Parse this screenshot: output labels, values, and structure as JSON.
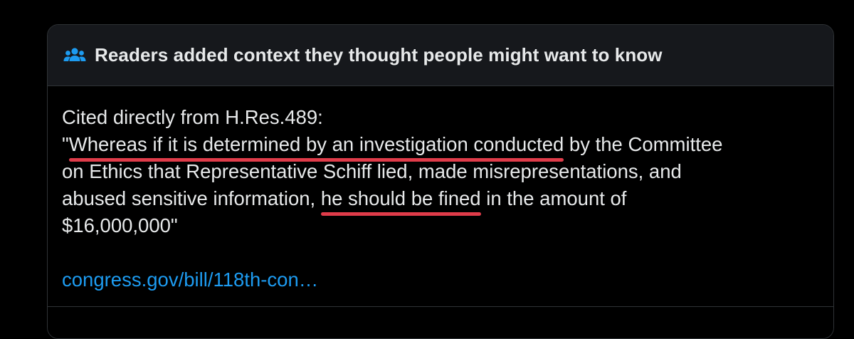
{
  "note_card": {
    "header_title": "Readers added context they thought people might want to know",
    "header_icon": "people-icon",
    "body": {
      "intro": "Cited directly from H.Res.489:",
      "line1_open_quote": "\"",
      "line1_highlight": "Whereas if it is determined by an investigation conducted",
      "line1_rest": " by the Committee",
      "line2": "on Ethics that Representative Schiff lied, made misrepresentations, and",
      "line3_pre": "abused sensitive information, ",
      "line3_highlight": "he should be fined",
      "line3_post": " in the amount of",
      "line4": "$16,000,000\""
    },
    "link_text": "congress.gov/bill/118th-con…",
    "colors": {
      "text": "#e7e9ea",
      "link": "#1d9bf0",
      "underline": "#e03c4a",
      "header_bg": "#16181c",
      "border": "#2f3336"
    }
  }
}
